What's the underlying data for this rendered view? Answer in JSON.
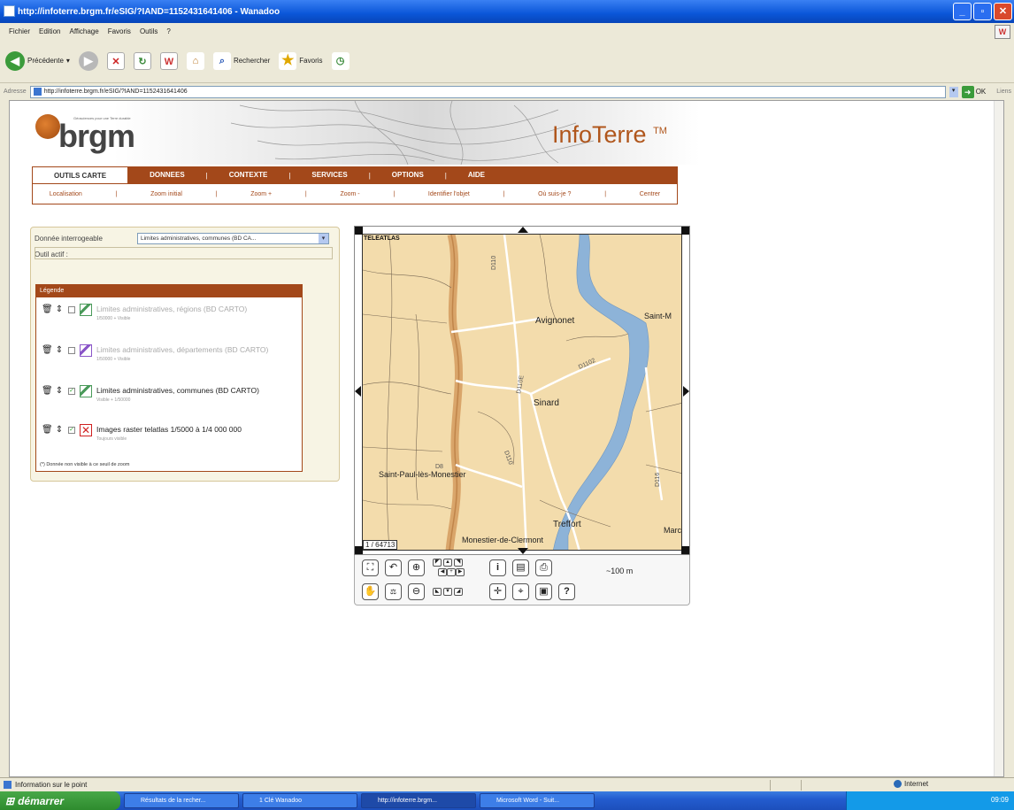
{
  "window": {
    "title": "http://infoterre.brgm.fr/eSIG/?IAND=1152431641406 - Wanadoo"
  },
  "menu": [
    "Fichier",
    "Edition",
    "Affichage",
    "Favoris",
    "Outils",
    "?"
  ],
  "toolbar": {
    "back": "Précédente",
    "search": "Rechercher",
    "favorites": "Favoris"
  },
  "address": {
    "label": "Adresse",
    "url": "http://infoterre.brgm.fr/eSIG/?IAND=1152431641406",
    "go": "OK",
    "links": "Liens"
  },
  "header": {
    "logo": "brgm",
    "tagline": "Géosciences pour une Terre durable",
    "app_title": "InfoTerre",
    "tm": "TM"
  },
  "nav": {
    "tabs": [
      "OUTILS CARTE",
      "DONNEES",
      "CONTEXTE",
      "SERVICES",
      "OPTIONS",
      "AIDE"
    ],
    "active": "OUTILS CARTE",
    "sub": [
      "Localisation",
      "Zoom initial",
      "Zoom +",
      "Zoom -",
      "Identifier l'objet",
      "Où suis-je ?",
      "Centrer"
    ]
  },
  "panel": {
    "data_label": "Donnée interrogeable",
    "data_value": "Limites administratives, communes (BD CA...",
    "tool_label": "Outil actif :",
    "legend_title": "Légende",
    "legend_items": [
      {
        "label": "Limites administratives, régions (BD CARTO)",
        "sub": "1/50000 + Visible",
        "checked": false,
        "muted": true,
        "color": "#4a9a5a"
      },
      {
        "label": "Limites administratives, départements (BD CARTO)",
        "sub": "1/50000 + Visible",
        "checked": false,
        "muted": true,
        "color": "#8a55c8"
      },
      {
        "label": "Limites administratives, communes (BD CARTO)",
        "sub": "Visible + 1/50000",
        "checked": true,
        "muted": false,
        "color": "#4a9a5a"
      },
      {
        "label": "Images raster telatlas 1/5000 à 1/4 000 000",
        "sub": "Toujours visible",
        "checked": true,
        "muted": false,
        "color": "#d02020"
      }
    ],
    "legend_note": "(*) Donnée non visible à ce seuil de zoom"
  },
  "map": {
    "brand": "TELEATLAS",
    "scale": "1 / 64713",
    "scale_bar": "~100 m",
    "places": [
      "Avignonet",
      "Sinard",
      "Saint-Paul-lès-Monestier",
      "Treffort",
      "Monestier-de-Clermont",
      "Saint-M",
      "Marc"
    ],
    "roads": [
      "D110",
      "D8",
      "D110E",
      "D110",
      "D116",
      "D1102"
    ]
  },
  "status": {
    "text": "Information sur le point",
    "zone": "Internet"
  },
  "taskbar": {
    "start": "démarrer",
    "tasks": [
      "Résultats de la recher...",
      "1 Clé Wanadoo",
      "http://infoterre.brgm...",
      "Microsoft Word - Suit..."
    ],
    "clock": "09:09"
  }
}
